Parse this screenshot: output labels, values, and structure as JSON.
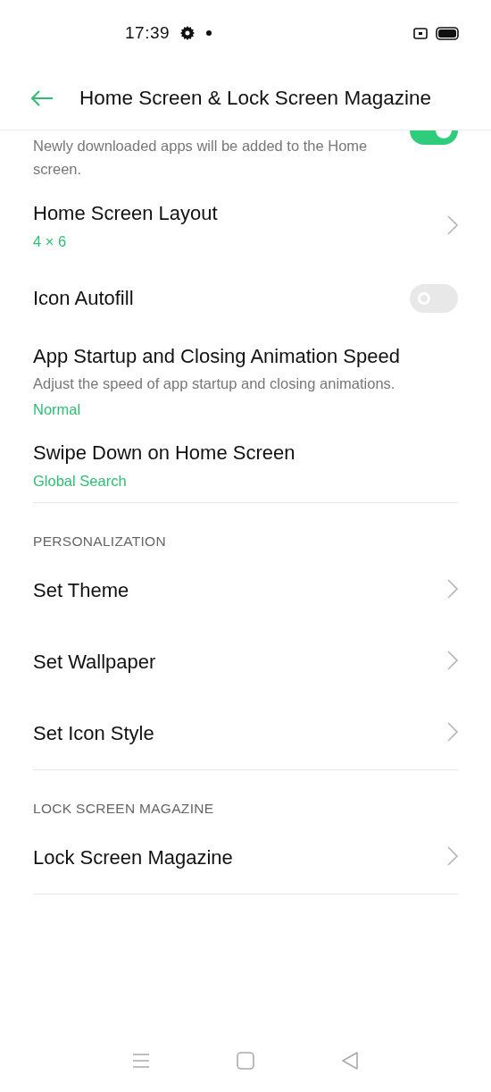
{
  "status_bar": {
    "time": "17:39"
  },
  "header": {
    "title": "Home Screen & Lock Screen Magazine"
  },
  "sections": [
    {
      "items": [
        {
          "kind": "toggle",
          "description": "Newly downloaded apps will be added to the Home screen.",
          "on": true
        },
        {
          "kind": "link",
          "title": "Home Screen Layout",
          "value": "4 × 6"
        },
        {
          "kind": "toggle",
          "title": "Icon Autofill",
          "on": false
        },
        {
          "kind": "text",
          "title": "App Startup and Closing Animation Speed",
          "description": "Adjust the speed of app startup and closing animations.",
          "value": "Normal"
        },
        {
          "kind": "text",
          "title": "Swipe Down on Home Screen",
          "value": "Global Search"
        }
      ]
    },
    {
      "title": "PERSONALIZATION",
      "items": [
        {
          "kind": "link",
          "title": "Set Theme"
        },
        {
          "kind": "link",
          "title": "Set Wallpaper"
        },
        {
          "kind": "link",
          "title": "Set Icon Style"
        }
      ]
    },
    {
      "title": "LOCK SCREEN MAGAZINE",
      "items": [
        {
          "kind": "link",
          "title": "Lock Screen Magazine"
        }
      ]
    }
  ]
}
